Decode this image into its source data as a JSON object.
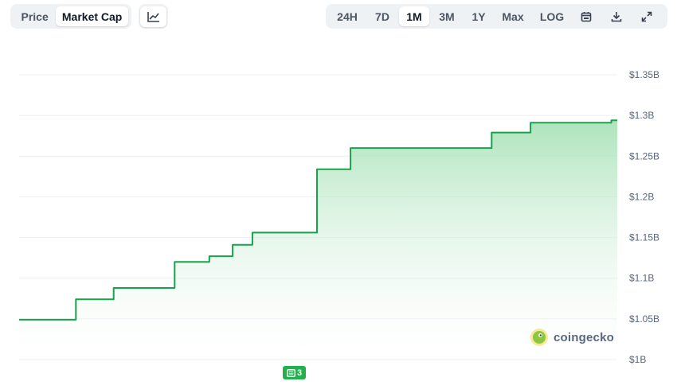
{
  "tabs": {
    "price_label": "Price",
    "market_cap_label": "Market Cap",
    "active": "Market Cap"
  },
  "chart_type_icon": "line-chart-icon",
  "ranges": {
    "items": [
      "24H",
      "7D",
      "1M",
      "3M",
      "1Y",
      "Max",
      "LOG"
    ],
    "active": "1M",
    "icons": [
      "calendar-icon",
      "download-icon",
      "expand-icon"
    ]
  },
  "colors": {
    "line": "#16a34a",
    "fill_top": "#9fdfb0",
    "grid": "#eceff2",
    "badge": "#22b14c"
  },
  "watermark": {
    "text": "coingecko"
  },
  "news_badge": {
    "count": "3",
    "icon": "newspaper-icon"
  },
  "chart_data": {
    "type": "area",
    "title": "",
    "xlabel": "",
    "ylabel": "",
    "ylim": [
      1.0,
      1.35
    ],
    "y_ticks": [
      1.0,
      1.05,
      1.1,
      1.15,
      1.2,
      1.25,
      1.3,
      1.35
    ],
    "y_tick_labels": [
      "$1B",
      "$1.05B",
      "$1.1B",
      "$1.15B",
      "$1.2B",
      "$1.25B",
      "$1.3B",
      "$1.35B"
    ],
    "grid": true,
    "series": [
      {
        "x": [
          0,
          0.095,
          0.095,
          0.158,
          0.158,
          0.26,
          0.26,
          0.318,
          0.318,
          0.357,
          0.357,
          0.39,
          0.39,
          0.498,
          0.498,
          0.554,
          0.554,
          0.79,
          0.79,
          0.855,
          0.855,
          0.99,
          0.99,
          1.0
        ],
        "values": [
          1.049,
          1.049,
          1.074,
          1.074,
          1.088,
          1.088,
          1.12,
          1.12,
          1.127,
          1.127,
          1.141,
          1.141,
          1.156,
          1.156,
          1.234,
          1.234,
          1.26,
          1.26,
          1.279,
          1.279,
          1.291,
          1.291,
          1.294,
          1.294
        ]
      }
    ]
  }
}
